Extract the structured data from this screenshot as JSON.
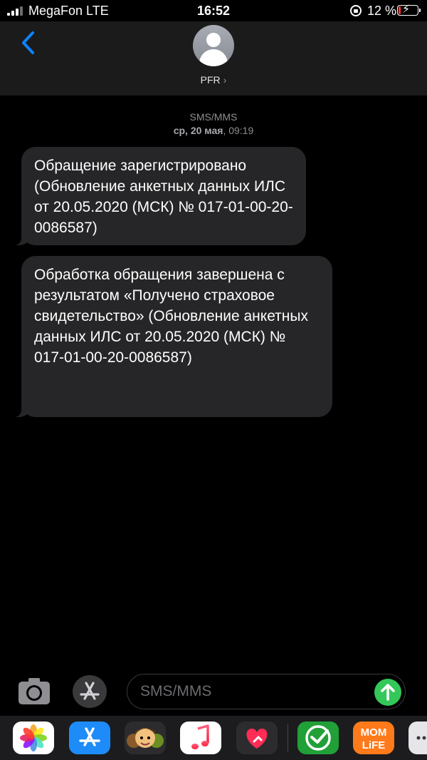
{
  "status_bar": {
    "carrier": "MegaFon LTE",
    "time": "16:52",
    "battery_percent": "12 %",
    "battery_level": 0.12,
    "battery_color": "#ff3b30"
  },
  "header": {
    "contact_name": "PFR",
    "contact_chevron": "›",
    "back_icon": "chevron-left-icon"
  },
  "thread": {
    "message_type": "SMS/MMS",
    "date_day": "ср, 20 мая",
    "date_time": ", 09:19",
    "messages": [
      {
        "text": "Обращение зарегистрировано (Обновление анкетных данных ИЛС от 20.05.2020 (МСК) № 017-01-00-20-0086587)"
      },
      {
        "text": "Обработка обращения завершена с результатом «Получено страховое\nсвидетельство» (Обновление анкетных данных ИЛС от 20.05.2020 (МСК) № 017-01-00-20-0086587)"
      }
    ]
  },
  "composer": {
    "placeholder": "SMS/MMS",
    "value": "",
    "send_color": "#34c759",
    "camera_icon": "camera-icon",
    "appstore_icon": "appstore-icon"
  },
  "app_drawer": {
    "apps": [
      "photos-icon",
      "appstore-icon",
      "memoji-icon",
      "music-icon",
      "hearts-icon",
      "sberbank-icon",
      "mom-life-icon",
      "more-icon"
    ],
    "momlife_label_1": "MOM",
    "momlife_label_2": "LiFE"
  },
  "colors": {
    "accent": "#0a84ff",
    "bubble": "#262628",
    "background": "#000000",
    "header": "#1b1b1b"
  }
}
